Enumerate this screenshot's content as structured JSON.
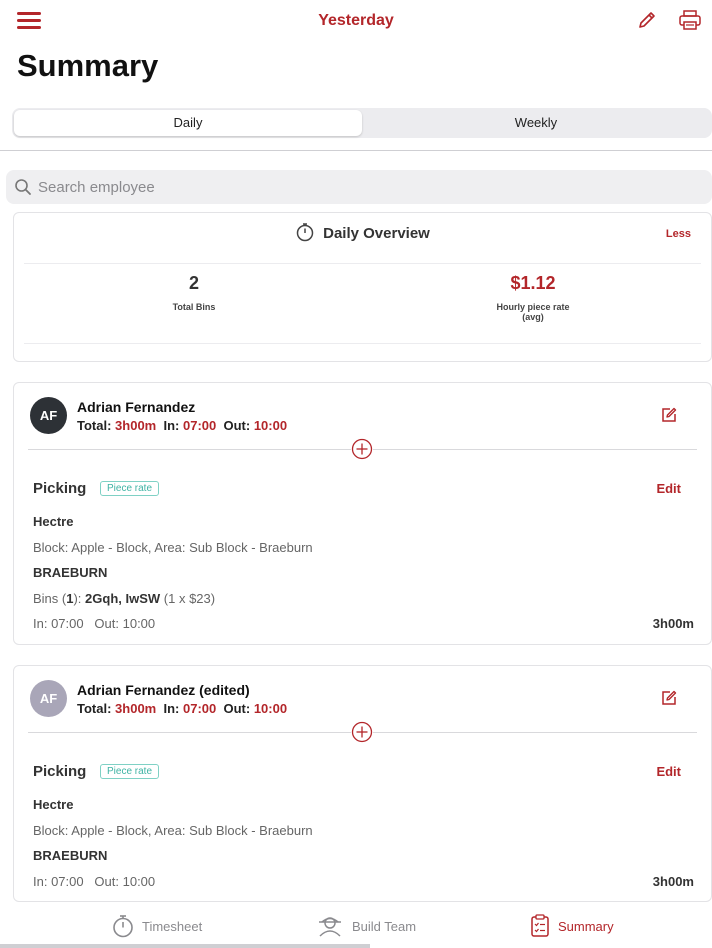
{
  "header": {
    "title": "Yesterday",
    "icons": [
      "menu-icon",
      "pencil-icon",
      "printer-icon"
    ]
  },
  "page_title": "Summary",
  "segments": {
    "daily": "Daily",
    "weekly": "Weekly",
    "selected": "Daily"
  },
  "search": {
    "placeholder": "Search employee"
  },
  "overview": {
    "title": "Daily Overview",
    "toggle": "Less",
    "total_bins": {
      "value": "2",
      "label": "Total Bins"
    },
    "hourly_rate": {
      "value": "$1.12",
      "label_line1": "Hourly piece rate",
      "label_line2": "(avg)"
    }
  },
  "employees": [
    {
      "initials": "AF",
      "avatar_color": "#2d3136",
      "name": "Adrian Fernandez",
      "total_label": "Total:",
      "total": "3h00m",
      "in_label": "In:",
      "in": "07:00",
      "out_label": "Out:",
      "out": "10:00",
      "task": {
        "title": "Picking",
        "badge": "Piece rate",
        "edit": "Edit",
        "location": "Hectre",
        "block": "Block: Apple - Block, Area: Sub Block - Braeburn",
        "variety": "BRAEBURN",
        "bins_prefix": "Bins (",
        "bins_count": "1",
        "bins_suffix": "):",
        "bins_codes": "2Gqh, IwSW",
        "bins_detail": "(1 x $23)",
        "times": "In: 07:00   Out: 10:00",
        "duration": "3h00m"
      }
    },
    {
      "initials": "AF",
      "avatar_color": "#a9a6b8",
      "name": "Adrian Fernandez (edited)",
      "total_label": "Total:",
      "total": "3h00m",
      "in_label": "In:",
      "in": "07:00",
      "out_label": "Out:",
      "out": "10:00",
      "task": {
        "title": "Picking",
        "badge": "Piece rate",
        "edit": "Edit",
        "location": "Hectre",
        "block": "Block: Apple - Block, Area: Sub Block - Braeburn",
        "variety": "BRAEBURN",
        "times": "In: 07:00   Out: 10:00",
        "duration": "3h00m"
      }
    }
  ],
  "tabs": [
    {
      "label": "Timesheet",
      "icon": "stopwatch-icon"
    },
    {
      "label": "Build Team",
      "icon": "team-icon"
    },
    {
      "label": "Summary",
      "icon": "checklist-icon",
      "active": true
    }
  ],
  "colors": {
    "accent": "#b3262a",
    "badge": "#3fb3a4"
  }
}
